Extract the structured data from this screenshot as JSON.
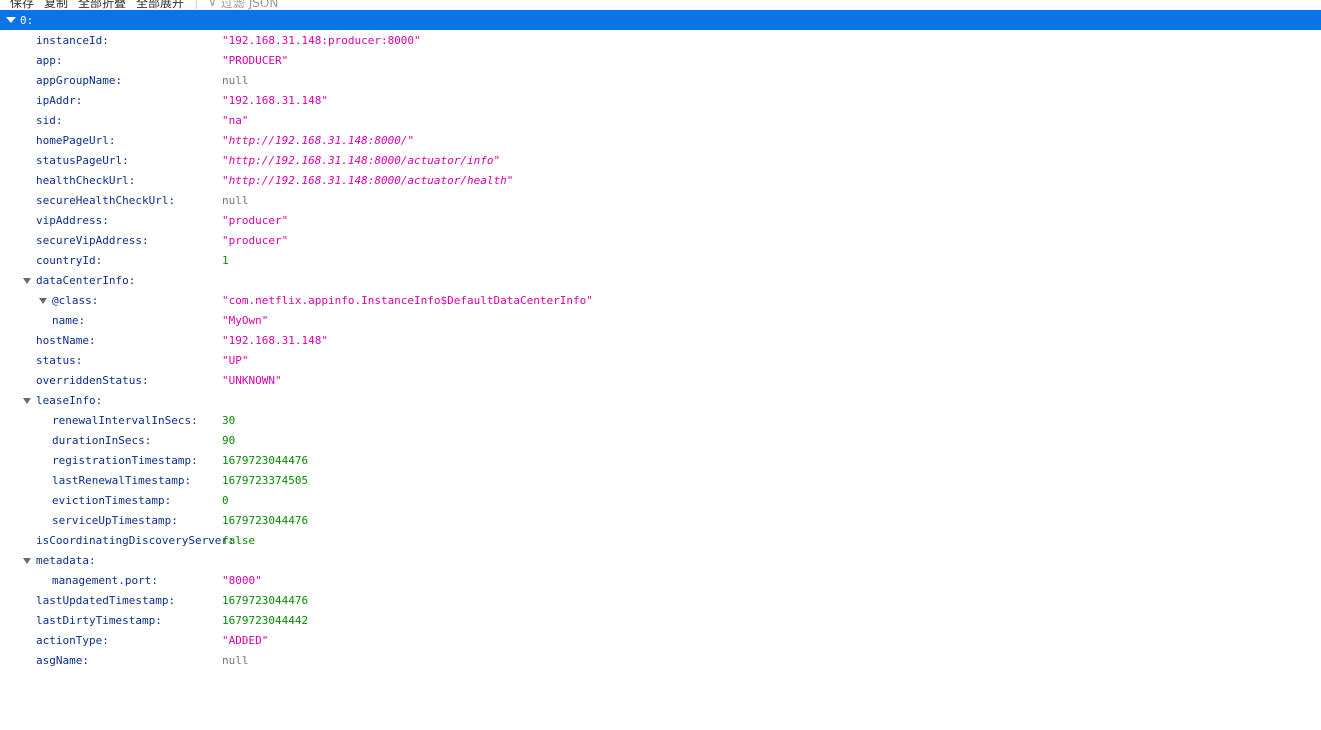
{
  "toolbar": {
    "save": "保存",
    "copy": "复制",
    "collapse_all": "全部折叠",
    "expand_all": "全部展开",
    "filter_placeholder": "过滤 JSON"
  },
  "root": {
    "key": "0:"
  },
  "rows": [
    {
      "key": "instanceId:",
      "value": "\"192.168.31.148:producer:8000\""
    },
    {
      "key": "app:",
      "value": "\"PRODUCER\""
    },
    {
      "key": "appGroupName:",
      "value": "null"
    },
    {
      "key": "ipAddr:",
      "value": "\"192.168.31.148\""
    },
    {
      "key": "sid:",
      "value": "\"na\""
    },
    {
      "key": "homePageUrl:",
      "value": "http://192.168.31.148:8000/"
    },
    {
      "key": "statusPageUrl:",
      "value": "http://192.168.31.148:8000/actuator/info"
    },
    {
      "key": "healthCheckUrl:",
      "value": "http://192.168.31.148:8000/actuator/health"
    },
    {
      "key": "secureHealthCheckUrl:",
      "value": "null"
    },
    {
      "key": "vipAddress:",
      "value": "\"producer\""
    },
    {
      "key": "secureVipAddress:",
      "value": "\"producer\""
    },
    {
      "key": "countryId:",
      "value": "1"
    },
    {
      "key": "dataCenterInfo:"
    },
    {
      "key": "@class:",
      "value": "\"com.netflix.appinfo.InstanceInfo$DefaultDataCenterInfo\""
    },
    {
      "key": "name:",
      "value": "\"MyOwn\""
    },
    {
      "key": "hostName:",
      "value": "\"192.168.31.148\""
    },
    {
      "key": "status:",
      "value": "\"UP\""
    },
    {
      "key": "overriddenStatus:",
      "value": "\"UNKNOWN\""
    },
    {
      "key": "leaseInfo:"
    },
    {
      "key": "renewalIntervalInSecs:",
      "value": "30"
    },
    {
      "key": "durationInSecs:",
      "value": "90"
    },
    {
      "key": "registrationTimestamp:",
      "value": "1679723044476"
    },
    {
      "key": "lastRenewalTimestamp:",
      "value": "1679723374505"
    },
    {
      "key": "evictionTimestamp:",
      "value": "0"
    },
    {
      "key": "serviceUpTimestamp:",
      "value": "1679723044476"
    },
    {
      "key": "isCoordinatingDiscoveryServer:",
      "value": "false"
    },
    {
      "key": "metadata:"
    },
    {
      "key": "management.port:",
      "value": "\"8000\""
    },
    {
      "key": "lastUpdatedTimestamp:",
      "value": "1679723044476"
    },
    {
      "key": "lastDirtyTimestamp:",
      "value": "1679723044442"
    },
    {
      "key": "actionType:",
      "value": "\"ADDED\""
    },
    {
      "key": "asgName:",
      "value": "null"
    }
  ],
  "colors": {
    "selected_bg": "#0a73e6",
    "key": "#0b2f8f",
    "string": "#dd00a9",
    "number": "#058b00",
    "null": "#737373"
  }
}
